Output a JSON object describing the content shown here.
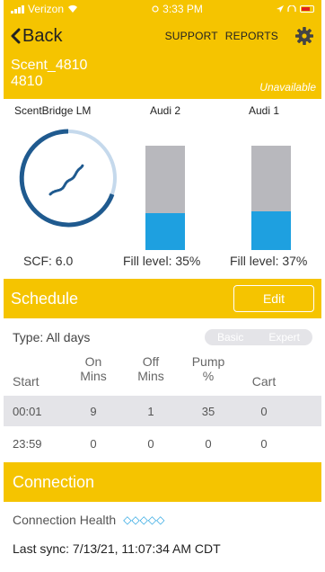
{
  "status_bar": {
    "carrier": "Verizon",
    "time": "3:33 PM"
  },
  "nav": {
    "back_label": "Back",
    "support_label": "SUPPORT",
    "reports_label": "REPORTS"
  },
  "device": {
    "name": "Scent_4810",
    "id": "4810",
    "status": "Unavailable"
  },
  "levels": {
    "lm_title": "ScentBridge LM",
    "audi2_title": "Audi 2",
    "audi1_title": "Audi 1",
    "scf_label": "SCF: 6.0",
    "audi2_fill_label": "Fill level: 35%",
    "audi1_fill_label": "Fill level: 37%",
    "audi2_fill_fraction": 0.35,
    "audi1_fill_fraction": 0.37
  },
  "schedule": {
    "title": "Schedule",
    "edit_label": "Edit",
    "type_label": "Type: All days",
    "mode_basic": "Basic",
    "mode_expert": "Expert",
    "columns": {
      "start": "Start",
      "on_line1": "On",
      "on_line2": "Mins",
      "off_line1": "Off",
      "off_line2": "Mins",
      "pump_line1": "Pump",
      "pump_line2": "%",
      "cart": "Cart"
    },
    "rows": [
      {
        "start": "00:01",
        "on": "9",
        "off": "1",
        "pump": "35",
        "cart": "0"
      },
      {
        "start": "23:59",
        "on": "0",
        "off": "0",
        "pump": "0",
        "cart": "0"
      }
    ]
  },
  "connection": {
    "title": "Connection",
    "health_label": "Connection Health",
    "health_diamonds": "◇◇◇◇◇",
    "last_sync": "Last sync: 7/13/21, 11:07:34 AM CDT"
  },
  "colors": {
    "accent": "#f5c400",
    "fill": "#1ea0e0",
    "bar_empty": "#b8b8bd"
  }
}
